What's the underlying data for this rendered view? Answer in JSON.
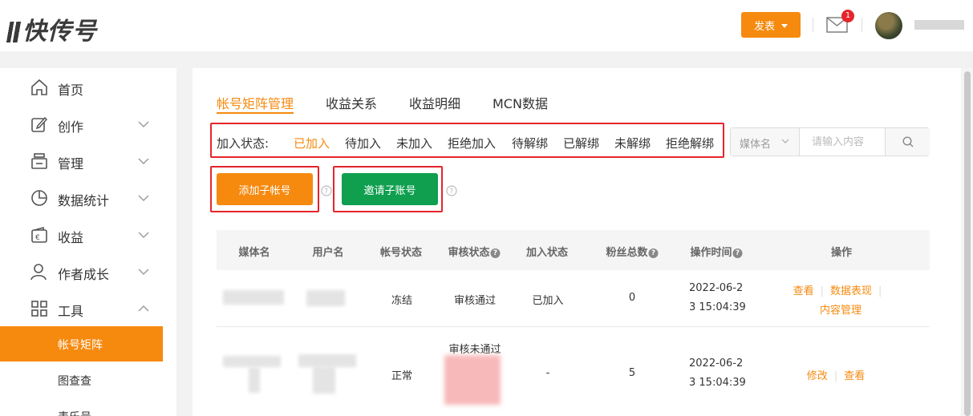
{
  "header": {
    "logo_text": "快传号",
    "publish_label": "发表",
    "mail_badge": "1"
  },
  "sidebar": {
    "items": [
      {
        "label": "首页"
      },
      {
        "label": "创作"
      },
      {
        "label": "管理"
      },
      {
        "label": "数据统计"
      },
      {
        "label": "收益"
      },
      {
        "label": "作者成长"
      },
      {
        "label": "工具"
      }
    ],
    "sub_items": [
      {
        "label": "帐号矩阵",
        "active": true
      },
      {
        "label": "图查查"
      },
      {
        "label": "表乐号"
      }
    ]
  },
  "main": {
    "tabs": [
      {
        "label": "帐号矩阵管理",
        "active": true
      },
      {
        "label": "收益关系"
      },
      {
        "label": "收益明细"
      },
      {
        "label": "MCN数据"
      }
    ],
    "filter": {
      "label": "加入状态:",
      "options": [
        "已加入",
        "待加入",
        "未加入",
        "拒绝加入",
        "待解绑",
        "已解绑",
        "未解绑",
        "拒绝解绑"
      ],
      "active": "已加入"
    },
    "search": {
      "select_value": "媒体名",
      "placeholder": "请输入内容"
    },
    "buttons": {
      "add_label": "添加子帐号",
      "invite_label": "邀请子账号"
    },
    "table": {
      "headers": [
        "媒体名",
        "用户名",
        "帐号状态",
        "审核状态",
        "加入状态",
        "粉丝总数",
        "操作时间",
        "操作"
      ],
      "rows": [
        {
          "account_status": "冻结",
          "review_status": "审核通过",
          "join_status": "已加入",
          "fans": "0",
          "time_line1": "2022-06-2",
          "time_line2": "3 15:04:39",
          "actions": [
            "查看",
            "数据表现",
            "内容管理"
          ]
        },
        {
          "account_status": "正常",
          "review_status": "审核未通过",
          "join_status": "-",
          "fans": "5",
          "time_line1": "2022-06-2",
          "time_line2": "3 15:04:39",
          "actions": [
            "修改",
            "查看"
          ]
        }
      ]
    }
  },
  "colors": {
    "accent": "#f68a0f",
    "green": "#0f9f4f",
    "highlight": "#e5242b"
  }
}
